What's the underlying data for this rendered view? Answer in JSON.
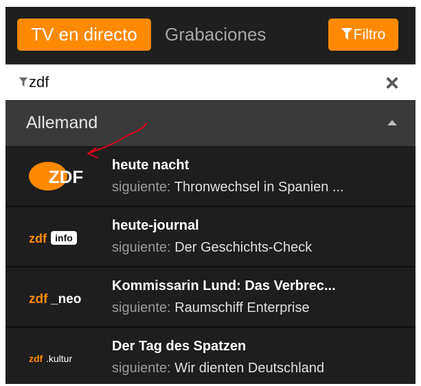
{
  "header": {
    "tab_live": "TV en directo",
    "tab_recordings": "Grabaciones",
    "filter_button": "Filtro"
  },
  "search": {
    "value": "zdf"
  },
  "group": {
    "title": "Allemand"
  },
  "channels": [
    {
      "logo": "zdf-logo",
      "program": "heute nacht",
      "next_label": "siguiente:",
      "next_program": "Thronwechsel in Spanien ..."
    },
    {
      "logo": "zdfinfo-logo",
      "program": "heute-journal",
      "next_label": "siguiente:",
      "next_program": "Der Geschichts-Check"
    },
    {
      "logo": "zdfneo-logo",
      "program": "Kommissarin Lund: Das Verbrec...",
      "next_label": "siguiente:",
      "next_program": "Raumschiff Enterprise"
    },
    {
      "logo": "zdfkultur-logo",
      "program": "Der Tag des Spatzen",
      "next_label": "siguiente:",
      "next_program": "Wir dienten Deutschland"
    }
  ],
  "logos": {
    "zdf_text": "ZDF",
    "info_prefix": "zdf",
    "info_badge": "info",
    "neo_prefix": "zdf",
    "neo_suffix": "_neo",
    "kultur_prefix": "zdf",
    "kultur_suffix": ".kultur"
  },
  "colors": {
    "accent": "#ff8a00",
    "panel": "#1e1e1e",
    "annotation": "#e0001a"
  }
}
